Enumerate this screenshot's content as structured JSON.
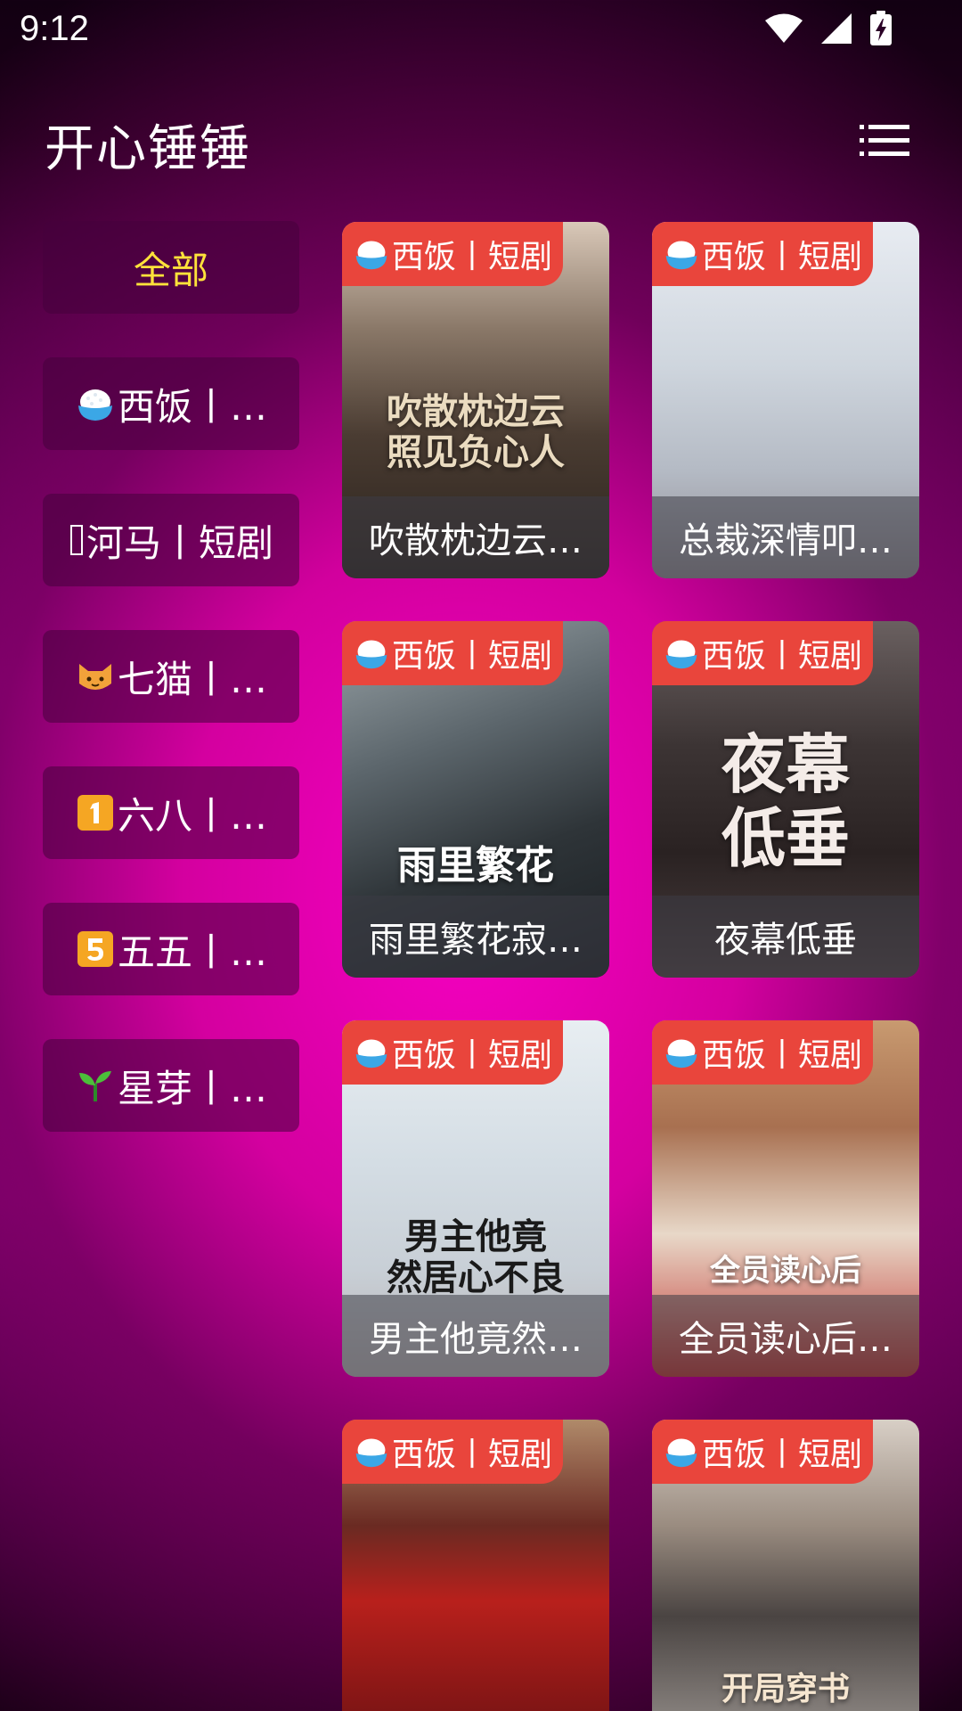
{
  "status_bar": {
    "time": "9:12",
    "icons": [
      "wifi-icon",
      "signal-icon",
      "battery-charging-icon"
    ]
  },
  "header": {
    "title": "开心锤锤",
    "menu_icon": "list-menu-icon"
  },
  "sidebar": {
    "items": [
      {
        "label": "全部",
        "icon": "",
        "active": true
      },
      {
        "label": "西饭丨…",
        "icon": "rice-bowl-icon",
        "active": false
      },
      {
        "label": "河马丨短剧",
        "icon": "missing-glyph-icon",
        "active": false
      },
      {
        "label": "七猫丨…",
        "icon": "cat-face-icon",
        "active": false
      },
      {
        "label": "六八丨…",
        "icon": "keycap-1-icon",
        "active": false
      },
      {
        "label": "五五丨…",
        "icon": "keycap-5-icon",
        "active": false
      },
      {
        "label": "星芽丨…",
        "icon": "seedling-icon",
        "active": false
      }
    ]
  },
  "cards": [
    {
      "badge": "西饭丨短剧",
      "title": "吹散枕边云…",
      "poster_text": "吹散枕边云\n照见负心人"
    },
    {
      "badge": "西饭丨短剧",
      "title": "总裁深情叩…",
      "poster_text": ""
    },
    {
      "badge": "西饭丨短剧",
      "title": "雨里繁花寂…",
      "poster_text": "雨里繁花"
    },
    {
      "badge": "西饭丨短剧",
      "title": "夜幕低垂",
      "poster_text": "夜幕\n低垂"
    },
    {
      "badge": "西饭丨短剧",
      "title": "男主他竟然…",
      "poster_text": "男主他竟\n然居心不良"
    },
    {
      "badge": "西饭丨短剧",
      "title": "全员读心后…",
      "poster_text": "全员读心后"
    },
    {
      "badge": "西饭丨短剧",
      "title": "",
      "poster_text": ""
    },
    {
      "badge": "西饭丨短剧",
      "title": "",
      "poster_text": "开局穿书"
    }
  ],
  "colors": {
    "accent_active": "#ffe23a",
    "badge_bg": "#e9453c",
    "background_magenta": "#ff00c8"
  }
}
